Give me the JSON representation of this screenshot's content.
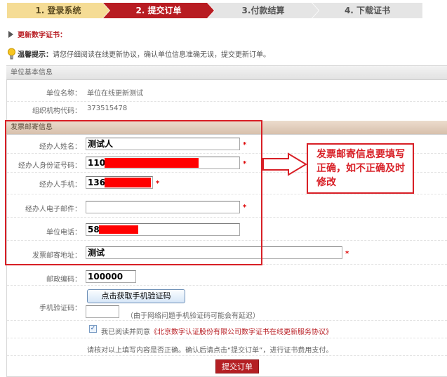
{
  "steps": [
    {
      "label": "1. 登录系统"
    },
    {
      "label": "2. 提交订单"
    },
    {
      "label": "3.付款结算"
    },
    {
      "label": "4. 下载证书"
    }
  ],
  "section_title": "更新数字证书：",
  "tip": {
    "prefix": "温馨提示：",
    "text": "请您仔细阅读在线更新协议，确认单位信息准确无误，提交更新订单。"
  },
  "unit_info": {
    "header": "单位基本信息",
    "name_label": "单位名称：",
    "name_value": "单位在线更新测试",
    "org_code_label": "组织机构代码：",
    "org_code_value": "373515478"
  },
  "mail_info": {
    "header": "发票邮寄信息",
    "operator_name_label": "经办人姓名：",
    "operator_name_value": "测试人",
    "operator_id_label": "经办人身份证号码：",
    "operator_id_value": "110",
    "operator_mobile_label": "经办人手机：",
    "operator_mobile_value": "136",
    "operator_email_label": "经办人电子邮件：",
    "operator_email_value": "",
    "unit_phone_label": "单位电话：",
    "unit_phone_value": "58",
    "address_label": "发票邮寄地址：",
    "address_value": "测试",
    "required_mark": "*"
  },
  "postal": {
    "label": "邮政编码：",
    "value": "100000"
  },
  "sms": {
    "label": "手机验证码：",
    "button": "点击获取手机验证码",
    "code_value": "",
    "hint": "（由于网络问题手机验证码可能会有延迟）"
  },
  "agreement": {
    "checked": true,
    "text": "我已阅读并同意",
    "link": "《北京数字认证股份有限公司数字证书在线更新服务协议》"
  },
  "confirm_text": "请核对以上填写内容是否正确。确认后请点击“提交订单”，进行证书费用支付。",
  "submit_button": "提交订单",
  "annotation": {
    "note": "发票邮寄信息要填写正确，如不正确及时修改"
  },
  "colors": {
    "brand_red": "#b81c22",
    "annotation_red": "#d81f26",
    "step_done": "#f5dc95",
    "step_pending": "#e5e5e5"
  }
}
